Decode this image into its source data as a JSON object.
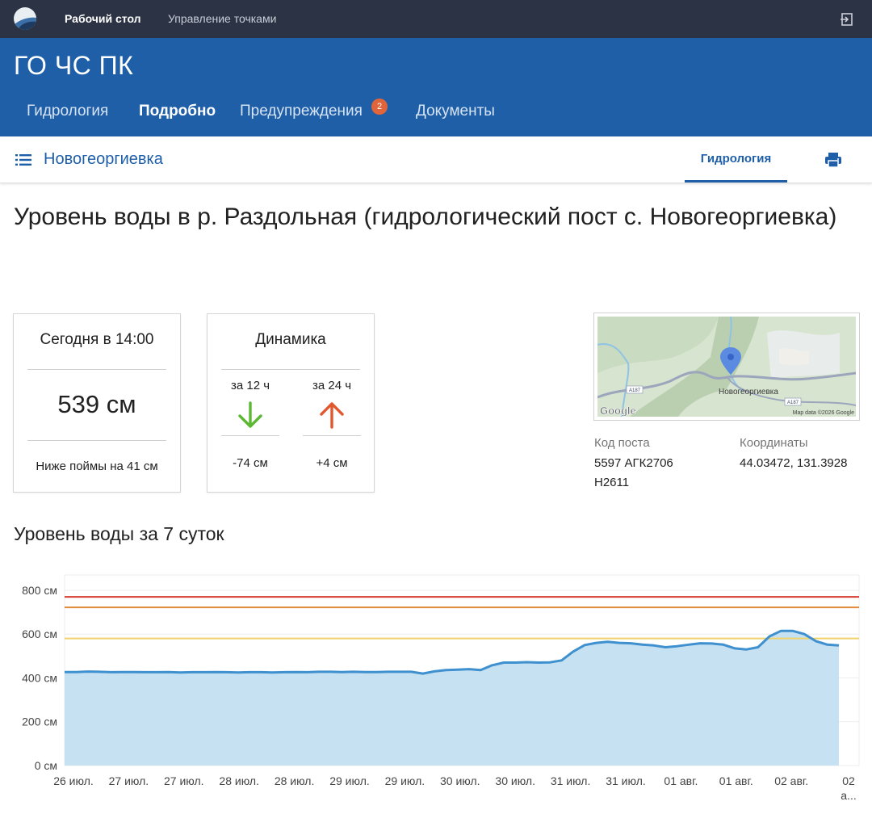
{
  "topbar": {
    "logo_icon": "wave-logo-icon",
    "nav": [
      "Рабочий стол",
      "Управление точками"
    ],
    "exit_icon": "logout-icon"
  },
  "header": {
    "title": "ГО ЧС ПК",
    "tabs": [
      {
        "label": "Гидрология",
        "active": false
      },
      {
        "label": "Подробно",
        "active": true
      },
      {
        "label": "Предупреждения",
        "active": false,
        "badge": "2"
      },
      {
        "label": "Документы",
        "active": false
      }
    ]
  },
  "subbar": {
    "menu_icon": "list-menu-icon",
    "place": "Новогеоргиевка",
    "tab": "Гидрология",
    "print_icon": "print-icon"
  },
  "page_title": "Уровень воды в р. Раздольная (гидрологический пост с. Новогеоргиевка)",
  "today": {
    "heading": "Сегодня в 14:00",
    "value": "539 см",
    "note": "Ниже поймы на 41 см"
  },
  "dynamics": {
    "heading": "Динамика",
    "items": [
      {
        "label": "за 12 ч",
        "delta": "-74 см",
        "direction": "down",
        "color": "#5cb832"
      },
      {
        "label": "за 24 ч",
        "delta": "+4 см",
        "direction": "up",
        "color": "#e2572e"
      }
    ]
  },
  "map": {
    "place_label": "Новогеоргиевка",
    "road_labels": [
      "A187",
      "A187"
    ],
    "attribution": "Map data ©2026 Google",
    "brand": "Google"
  },
  "post": {
    "code_label": "Код поста",
    "code_value_line1": "5597 АГК2706",
    "code_value_line2": "Н2611",
    "coords_label": "Координаты",
    "coords_value": "44.03472, 131.3928"
  },
  "chart_title": "Уровень воды за 7 суток",
  "chart_data": {
    "type": "area",
    "y_ticks": [
      "0 см",
      "200 см",
      "400 см",
      "600 см",
      "800 см"
    ],
    "ylim": [
      0,
      870
    ],
    "x_ticks": [
      "26 июл.",
      "27 июл.",
      "27 июл.",
      "28 июл.",
      "28 июл.",
      "29 июл.",
      "29 июл.",
      "30 июл.",
      "30 июл.",
      "31 июл.",
      "31 июл.",
      "01 авг.",
      "01 авг.",
      "02 авг.",
      "02 а..."
    ],
    "thresholds": [
      {
        "value": 770,
        "color": "#d63b2f"
      },
      {
        "value": 722,
        "color": "#e08a3c"
      },
      {
        "value": 580,
        "color": "#f0d26a"
      }
    ],
    "series": [
      {
        "color": "#3f90cf",
        "fill": "#c6e1f2",
        "values": [
          427,
          427,
          429,
          428,
          426,
          427,
          427,
          426,
          426,
          427,
          425,
          426,
          426,
          427,
          426,
          425,
          426,
          426,
          425,
          426,
          427,
          426,
          428,
          428,
          427,
          428,
          427,
          427,
          428,
          428,
          428,
          420,
          430,
          436,
          438,
          440,
          436,
          458,
          470,
          470,
          472,
          470,
          471,
          480,
          520,
          550,
          560,
          565,
          560,
          558,
          552,
          548,
          540,
          545,
          552,
          558,
          557,
          552,
          535,
          530,
          540,
          590,
          615,
          615,
          600,
          568,
          552,
          548
        ]
      }
    ]
  }
}
